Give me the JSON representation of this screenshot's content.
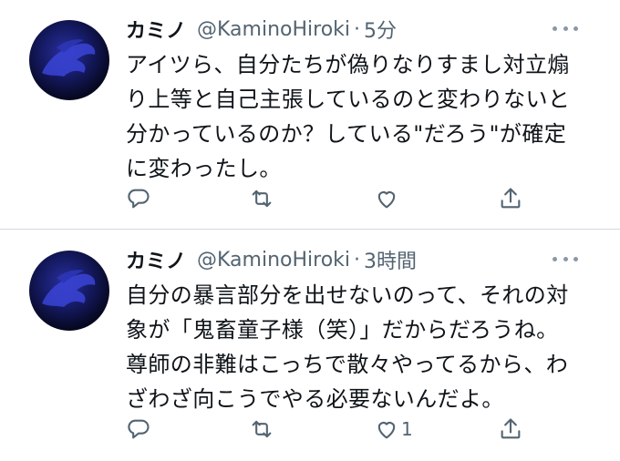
{
  "tweets": [
    {
      "name": "カミノ",
      "handle": "@KaminoHiroki",
      "separator": "·",
      "time": "5分",
      "lines": [
        "アイツら、自分たちが偽りなりすまし対立煽",
        "り上等と自己主張しているのと変わりないと",
        "分かっているのか？している\"だろう\"が確定",
        "に変わったし。"
      ],
      "like_count": ""
    },
    {
      "name": "カミノ",
      "handle": "@KaminoHiroki",
      "separator": "·",
      "time": "3時間",
      "lines": [
        "自分の暴言部分を出せないのって、それの対",
        "象が「鬼畜童子様（笑）」だからだろうね。",
        "尊師の非難はこっちで散々やってるから、わ",
        "ざわざ向こうでやる必要ないんだよ。"
      ],
      "like_count": "1"
    }
  ],
  "colors": {
    "text": "#0f1419",
    "secondary": "#536471",
    "divider": "#cfd9de"
  },
  "icons": [
    "reply-icon",
    "retweet-icon",
    "like-icon",
    "share-icon",
    "more-icon"
  ]
}
